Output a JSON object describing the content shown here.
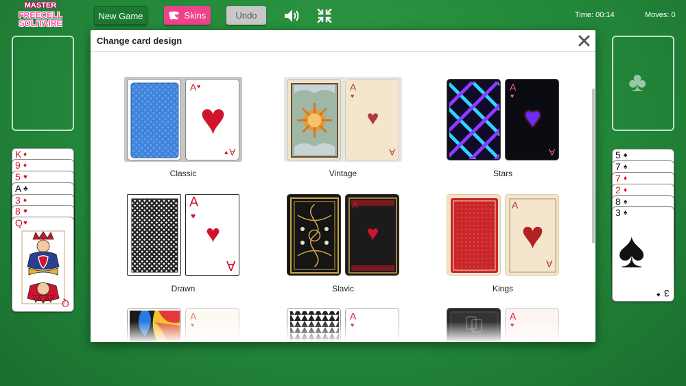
{
  "app": {
    "logo": {
      "line1": "MASTER",
      "line2": "FREECELL",
      "line3": "SOLITAIRE"
    }
  },
  "toolbar": {
    "new_game_label": "New Game",
    "skins_label": "Skins",
    "undo_label": "Undo",
    "sound_icon": "speaker-icon",
    "fullscreen_icon": "collapse-icon"
  },
  "stats": {
    "time": "Time: 00:14",
    "moves": "Moves: 0"
  },
  "colors": {
    "felt": "#23873a",
    "new_game_button": "#1c7a30",
    "skins_button": "#f0428b",
    "undo_button": "#c8c8c8",
    "card_red": "#d0142c"
  },
  "left_column": {
    "cards": [
      {
        "rank": "K",
        "suit": "♦"
      },
      {
        "rank": "9",
        "suit": "♦"
      },
      {
        "rank": "5",
        "suit": "♥"
      },
      {
        "rank": "A",
        "suit": "♣"
      },
      {
        "rank": "3",
        "suit": "♦"
      },
      {
        "rank": "8",
        "suit": "♥"
      },
      {
        "rank": "Q",
        "suit": "♥"
      }
    ]
  },
  "right_column": {
    "foundation_suit": "♣",
    "cards": [
      {
        "rank": "5",
        "suit": "♠"
      },
      {
        "rank": "7",
        "suit": "♠"
      },
      {
        "rank": "7",
        "suit": "♦"
      },
      {
        "rank": "2",
        "suit": "♦"
      },
      {
        "rank": "8",
        "suit": "♠"
      },
      {
        "rank": "3",
        "suit": "♠"
      }
    ]
  },
  "modal": {
    "title": "Change card design",
    "close_icon": "close-icon",
    "skins": [
      {
        "name": "Classic",
        "selected": true,
        "face_rank": "A",
        "face_suit": "♥"
      },
      {
        "name": "Vintage",
        "selected": false,
        "face_rank": "A",
        "face_suit": "♥"
      },
      {
        "name": "Stars",
        "selected": false,
        "face_rank": "A",
        "face_suit": "♥"
      },
      {
        "name": "Drawn",
        "selected": false,
        "face_rank": "A",
        "face_suit": "♥"
      },
      {
        "name": "Slavic",
        "selected": false,
        "face_rank": "A",
        "face_suit": "♥"
      },
      {
        "name": "Kings",
        "selected": false,
        "face_rank": "A",
        "face_suit": "♥"
      },
      {
        "name": "",
        "selected": false,
        "face_rank": "A",
        "face_suit": "♥"
      },
      {
        "name": "",
        "selected": false,
        "face_rank": "A",
        "face_suit": "♥"
      },
      {
        "name": "",
        "selected": false,
        "face_rank": "A",
        "face_suit": "♥"
      }
    ]
  }
}
